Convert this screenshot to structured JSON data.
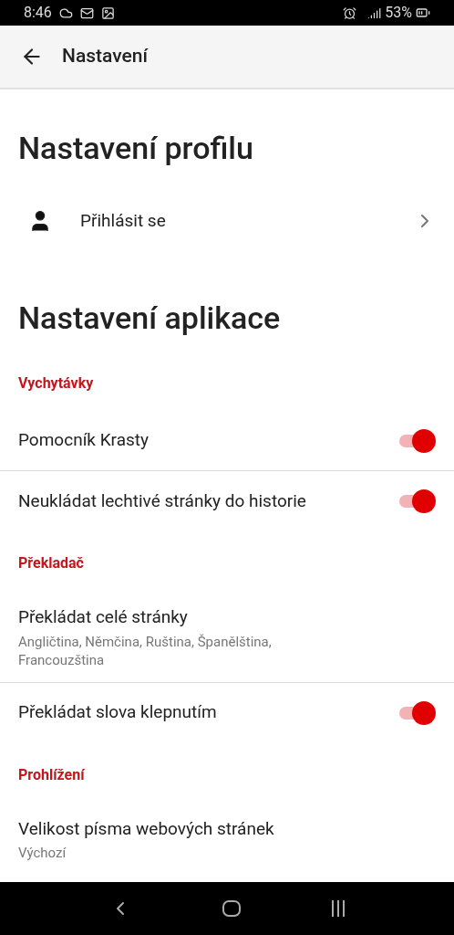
{
  "status_bar": {
    "time": "8:46",
    "battery": "53%"
  },
  "app_bar": {
    "title": "Nastavení"
  },
  "profile": {
    "heading": "Nastavení profilu",
    "login": "Přihlásit se"
  },
  "app_settings": {
    "heading": "Nastavení aplikace",
    "items": [
      {
        "kind": "section",
        "label": "Vychytávky"
      },
      {
        "kind": "toggle",
        "label": "Pomocník Krasty",
        "on": true
      },
      {
        "kind": "toggle",
        "label": "Neukládat lechtivé stránky do historie",
        "on": true
      },
      {
        "kind": "section",
        "label": "Překladač"
      },
      {
        "kind": "option",
        "label": "Překládat celé stránky",
        "detail": "Angličtina, Němčina, Ruština, Španělština, Francouzština"
      },
      {
        "kind": "toggle",
        "label": "Překládat slova klepnutím",
        "on": true
      },
      {
        "kind": "section",
        "label": "Prohlížení"
      },
      {
        "kind": "option",
        "label": "Velikost písma webových stránek",
        "detail": "Výchozí"
      }
    ]
  }
}
